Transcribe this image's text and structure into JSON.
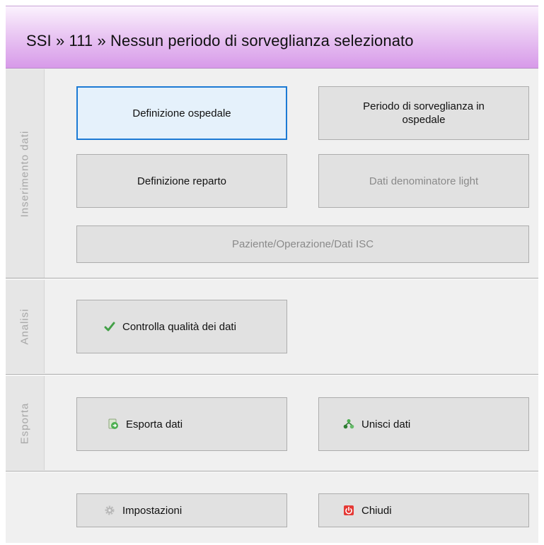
{
  "header": {
    "title": "SSI » 111 » Nessun periodo di sorveglianza selezionato"
  },
  "sections": {
    "inserimento": "Inserimento dati",
    "analisi": "Analisi",
    "esporta": "Esporta"
  },
  "buttons": {
    "definizione_ospedale": "Definizione ospedale",
    "periodo_sorveglianza": "Periodo di sorveglianza in ospedale",
    "definizione_reparto": "Definizione reparto",
    "dati_denominatore": "Dati denominatore light",
    "paziente_operazione": "Paziente/Operazione/Dati ISC",
    "controlla_qualita": "Controlla qualità dei dati",
    "esporta_dati": "Esporta dati",
    "unisci_dati": "Unisci dati",
    "impostazioni": "Impostazioni",
    "chiudi": "Chiudi"
  },
  "colors": {
    "header_accent": "#d79ae9",
    "focus_border": "#1c7ad4",
    "check_green": "#43a047",
    "close_red": "#e53935"
  },
  "icons": {
    "quality": "check-icon",
    "export": "export-icon",
    "merge": "merge-icon",
    "settings": "gear-icon",
    "close": "power-icon"
  }
}
